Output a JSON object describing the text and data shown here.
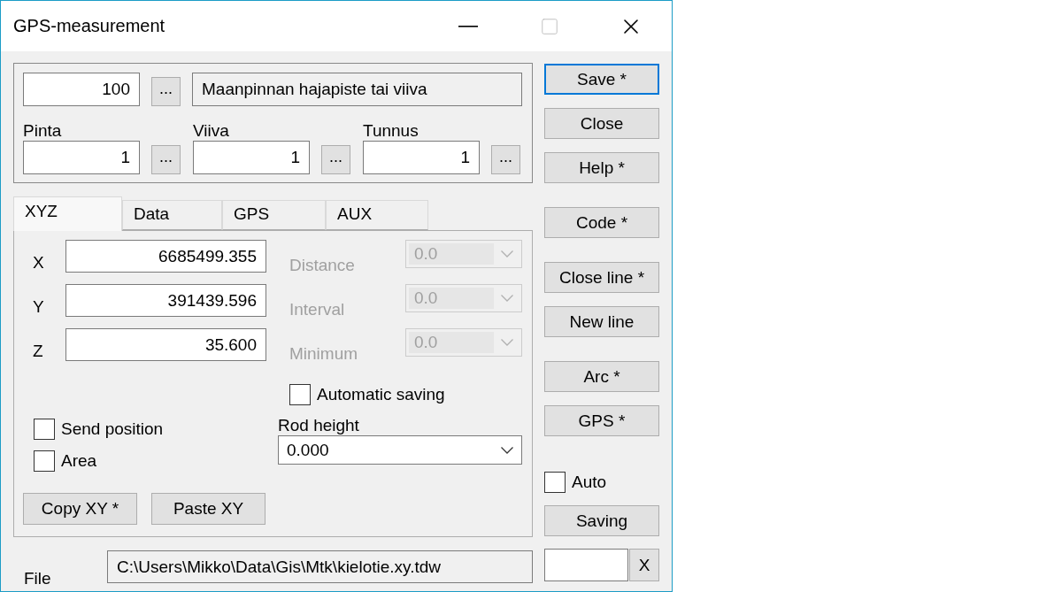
{
  "window": {
    "title": "GPS-measurement"
  },
  "code": {
    "value": "100",
    "browse": "...",
    "description": "Maanpinnan hajapiste tai viiva"
  },
  "attributes": [
    {
      "label": "Pinta",
      "value": "1",
      "browse": "..."
    },
    {
      "label": "Viiva",
      "value": "1",
      "browse": "..."
    },
    {
      "label": "Tunnus",
      "value": "1",
      "browse": "..."
    }
  ],
  "tabs": [
    {
      "label": "XYZ",
      "selected": true
    },
    {
      "label": "Data",
      "selected": false
    },
    {
      "label": "GPS",
      "selected": false
    },
    {
      "label": "AUX",
      "selected": false
    }
  ],
  "coordinates": [
    {
      "label": "X",
      "value": "6685499.355"
    },
    {
      "label": "Y",
      "value": "391439.596"
    },
    {
      "label": "Z",
      "value": "35.600"
    }
  ],
  "options": [
    {
      "label": "Distance",
      "value": "0.0",
      "disabled": true
    },
    {
      "label": "Interval",
      "value": "0.0",
      "disabled": true
    },
    {
      "label": "Minimum",
      "value": "0.0",
      "disabled": true
    }
  ],
  "automatic_saving": {
    "label": "Automatic saving",
    "checked": false
  },
  "checkboxes": [
    {
      "label": "Send position",
      "checked": false
    },
    {
      "label": "Area",
      "checked": false
    }
  ],
  "rod_height": {
    "label": "Rod height",
    "value": "0.000"
  },
  "tab_buttons": [
    "Copy XY *",
    "Paste XY"
  ],
  "file": {
    "label": "File",
    "value": "C:\\Users\\Mikko\\Data\\Gis\\Mtk\\kielotie.xy.tdw"
  },
  "side_groups": [
    [
      {
        "label": "Save *",
        "focused": true
      },
      {
        "label": "Close",
        "focused": false
      },
      {
        "label": "Help *",
        "focused": false
      }
    ],
    [
      {
        "label": "Code *",
        "focused": false
      }
    ],
    [
      {
        "label": "Close line *",
        "focused": false
      },
      {
        "label": "New line",
        "focused": false
      }
    ],
    [
      {
        "label": "Arc *",
        "focused": false
      },
      {
        "label": "GPS *",
        "focused": false
      }
    ]
  ],
  "auto": {
    "label": "Auto",
    "checked": false
  },
  "saving_button": "Saving",
  "clear_button": "X"
}
